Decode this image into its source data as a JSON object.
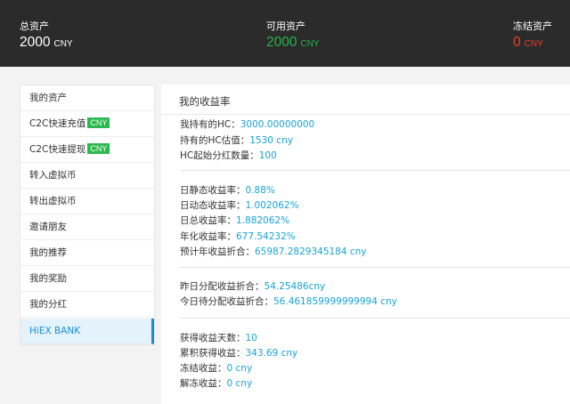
{
  "header": {
    "total": {
      "label": "总资产",
      "value": "2000",
      "unit": "CNY"
    },
    "available": {
      "label": "可用资产",
      "value": "2000",
      "unit": "CNY"
    },
    "frozen": {
      "label": "冻结资产",
      "value": "0",
      "unit": "CNY"
    }
  },
  "sidebar": {
    "items": [
      {
        "label": "我的资产"
      },
      {
        "label": "C2C快速充值",
        "badge": "CNY"
      },
      {
        "label": "C2C快速提现",
        "badge": "CNY"
      },
      {
        "label": "转入虚拟币"
      },
      {
        "label": "转出虚拟币"
      },
      {
        "label": "邀请朋友"
      },
      {
        "label": "我的推荐"
      },
      {
        "label": "我的奖励"
      },
      {
        "label": "我的分红"
      },
      {
        "label": "HiEX BANK",
        "active": true
      }
    ]
  },
  "main": {
    "title": "我的收益率",
    "groups": [
      [
        {
          "label": "我持有的HC：",
          "value": "3000.00000000"
        },
        {
          "label": "持有的HC估值：",
          "value": "1530 cny"
        },
        {
          "label": "HC起始分红数量：",
          "value": "100"
        }
      ],
      [
        {
          "label": "日静态收益率：",
          "value": "0.88%"
        },
        {
          "label": "日动态收益率：",
          "value": "1.002062%"
        },
        {
          "label": "日总收益率：",
          "value": "1.882062%"
        },
        {
          "label": "年化收益率：",
          "value": "677.54232%"
        },
        {
          "label": "预计年收益折合：",
          "value": "65987.2829345184 cny"
        }
      ],
      [
        {
          "label": "昨日分配收益折合：",
          "value": "54.25486cny"
        },
        {
          "label": "今日待分配收益折合：",
          "value": "56.461859999999994 cny"
        }
      ],
      [
        {
          "label": "获得收益天数：",
          "value": "10"
        },
        {
          "label": "累积获得收益：",
          "value": "343.69 cny"
        },
        {
          "label": "冻结收益：",
          "value": "0 cny"
        },
        {
          "label": "解冻收益：",
          "value": "0 cny"
        }
      ]
    ]
  },
  "colors": {
    "accent": "#17a3d8",
    "available": "#29b34a",
    "frozen": "#e8402a",
    "badge": "#2bb84f",
    "topbar": "#2b2b2b"
  }
}
